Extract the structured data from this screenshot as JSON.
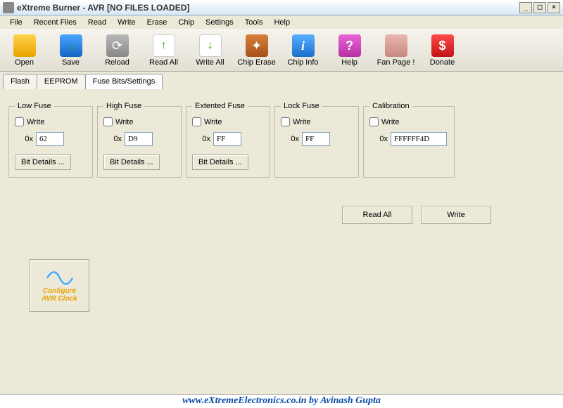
{
  "window": {
    "title": "eXtreme Burner - AVR [NO FILES LOADED]"
  },
  "menu": {
    "items": [
      "File",
      "Recent Files",
      "Read",
      "Write",
      "Erase",
      "Chip",
      "Settings",
      "Tools",
      "Help"
    ]
  },
  "toolbar": {
    "open": "Open",
    "save": "Save",
    "reload": "Reload",
    "readall": "Read All",
    "writeall": "Write All",
    "chiperase": "Chip Erase",
    "chipinfo": "Chip Info",
    "help": "Help",
    "fanpage": "Fan Page !",
    "donate": "Donate"
  },
  "tabs": {
    "flash": "Flash",
    "eeprom": "EEPROM",
    "fusebits": "Fuse Bits/Settings"
  },
  "fuse": {
    "writeLabel": "Write",
    "hexPrefix": "0x",
    "bitDetails": "Bit Details ...",
    "low": {
      "legend": "Low Fuse",
      "value": "62"
    },
    "high": {
      "legend": "High Fuse",
      "value": "D9"
    },
    "ext": {
      "legend": "Extented Fuse",
      "value": "FF"
    },
    "lock": {
      "legend": "Lock Fuse",
      "value": "FF"
    },
    "cal": {
      "legend": "Calibration",
      "value": "FFFFFF4D"
    }
  },
  "actions": {
    "readall": "Read All",
    "write": "Write"
  },
  "clock": {
    "line1": "Configure",
    "line2": "AVR Clock"
  },
  "footer": {
    "text": "www.eXtremeElectronics.co.in by Avinash Gupta"
  }
}
